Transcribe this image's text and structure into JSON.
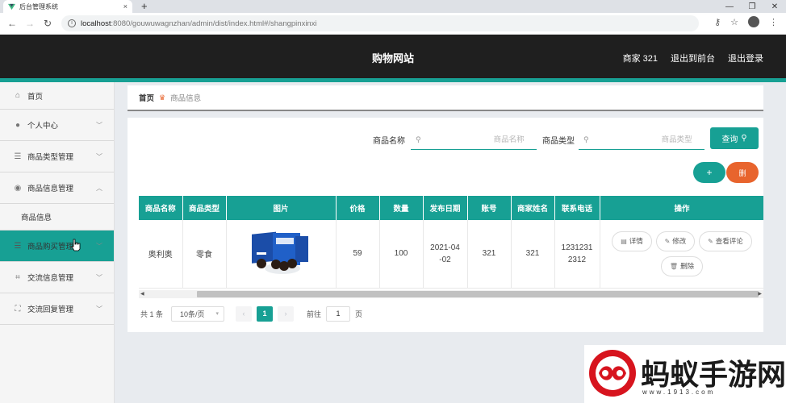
{
  "browser": {
    "tab_title": "后台管理系统",
    "tab_close": "×",
    "new_tab": "+",
    "url_host": "localhost",
    "url_path": ":8080/gouwuwagnzhan/admin/dist/index.html#/shangpinxinxi"
  },
  "header": {
    "title": "购物网站",
    "user": "商家 321",
    "back_to_front": "退出到前台",
    "logout": "退出登录"
  },
  "sidebar": {
    "items": [
      {
        "label": "首页",
        "icon": "home-icon",
        "chevron": ""
      },
      {
        "label": "个人中心",
        "icon": "user-icon",
        "chevron": "﹀"
      },
      {
        "label": "商品类型管理",
        "icon": "menu-icon",
        "chevron": "﹀"
      },
      {
        "label": "商品信息管理",
        "icon": "location-icon",
        "chevron": "︿"
      },
      {
        "label": "商品信息",
        "icon": "",
        "chevron": ""
      },
      {
        "label": "商品购买管理",
        "icon": "menu-icon",
        "chevron": "﹀"
      },
      {
        "label": "交流信息管理",
        "icon": "crop-icon",
        "chevron": "﹀"
      },
      {
        "label": "交流回复管理",
        "icon": "fullscreen-icon",
        "chevron": "﹀"
      }
    ]
  },
  "breadcrumb": {
    "home": "首页",
    "current": "商品信息"
  },
  "search": {
    "name_label": "商品名称",
    "name_placeholder": "商品名称",
    "type_label": "商品类型",
    "type_placeholder": "商品类型",
    "query_button": "查询"
  },
  "actions": {
    "add": "+",
    "delete": "删"
  },
  "table": {
    "columns": [
      "商品名称",
      "商品类型",
      "图片",
      "价格",
      "数量",
      "发布日期",
      "账号",
      "商家姓名",
      "联系电话",
      "操作"
    ],
    "rows": [
      {
        "name": "奥利奥",
        "type": "零食",
        "price": "59",
        "quantity": "100",
        "date_line1": "2021-04",
        "date_line2": "-02",
        "account": "321",
        "merchant": "321",
        "phone_line1": "1231231",
        "phone_line2": "2312",
        "ops": {
          "detail": "详情",
          "edit": "修改",
          "reviews": "查看评论",
          "delete": "删除"
        }
      }
    ]
  },
  "pagination": {
    "total": "共 1 条",
    "page_size": "10条/页",
    "current_page": "1",
    "goto_label": "前往",
    "goto_value": "1",
    "page_unit": "页"
  },
  "watermark": {
    "text": "蚂蚁手游网",
    "url": "www.1913.com"
  },
  "colors": {
    "accent": "#17a094",
    "danger": "#e8642d",
    "header_bg": "#1f1f1f"
  }
}
